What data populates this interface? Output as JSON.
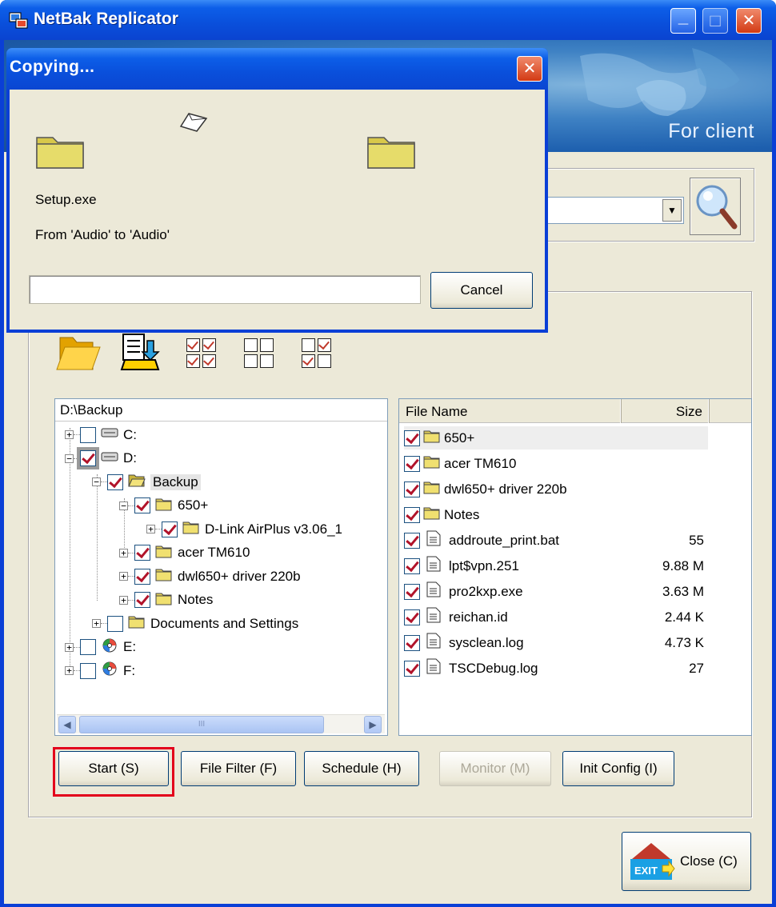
{
  "main_window": {
    "title": "NetBak Replicator",
    "banner_text": "For client",
    "controls": {
      "minimize": "_",
      "maximize": "□",
      "close": "✕"
    }
  },
  "copy_dialog": {
    "title": "Copying...",
    "file_name": "Setup.exe",
    "route": "From 'Audio' to 'Audio'",
    "cancel_label": "Cancel",
    "progress": 0
  },
  "tree": {
    "header": "D:\\Backup",
    "items": [
      {
        "label": "C:",
        "checked": false,
        "expander": "+",
        "icon": "drive-icon"
      },
      {
        "label": "D:",
        "checked": true,
        "expander": "−",
        "icon": "drive-icon"
      },
      {
        "label": "Backup",
        "checked": true,
        "expander": "−",
        "icon": "folder-open-icon"
      },
      {
        "label": "650+",
        "checked": true,
        "expander": "−",
        "icon": "folder-icon"
      },
      {
        "label": "D-Link AirPlus v3.06_1",
        "checked": true,
        "expander": "+",
        "icon": "folder-icon"
      },
      {
        "label": "acer TM610",
        "checked": true,
        "expander": "+",
        "icon": "folder-icon"
      },
      {
        "label": "dwl650+ driver 220b",
        "checked": true,
        "expander": "+",
        "icon": "folder-icon"
      },
      {
        "label": "Notes",
        "checked": true,
        "expander": "+",
        "icon": "folder-icon"
      },
      {
        "label": "Documents and Settings",
        "checked": false,
        "expander": "+",
        "icon": "folder-icon"
      },
      {
        "label": "E:",
        "checked": false,
        "expander": "+",
        "icon": "cd-drive-icon"
      },
      {
        "label": "F:",
        "checked": false,
        "expander": "+",
        "icon": "cd-drive-icon"
      }
    ],
    "scroll_thumb_mark": "III"
  },
  "files": {
    "columns": {
      "name": "File Name",
      "size": "Size"
    },
    "rows": [
      {
        "name": "650+",
        "size": "",
        "type": "folder"
      },
      {
        "name": "acer TM610",
        "size": "",
        "type": "folder"
      },
      {
        "name": "dwl650+ driver 220b",
        "size": "",
        "type": "folder"
      },
      {
        "name": "Notes",
        "size": "",
        "type": "folder"
      },
      {
        "name": "addroute_print.bat",
        "size": "55",
        "type": "file"
      },
      {
        "name": "lpt$vpn.251",
        "size": "9.88 M",
        "type": "file"
      },
      {
        "name": "pro2kxp.exe",
        "size": "3.63 M",
        "type": "file"
      },
      {
        "name": "reichan.id",
        "size": "2.44 K",
        "type": "file"
      },
      {
        "name": "sysclean.log",
        "size": "4.73 K",
        "type": "file"
      },
      {
        "name": "TSCDebug.log",
        "size": "27",
        "type": "file"
      }
    ]
  },
  "buttons": {
    "start": "Start (S)",
    "file_filter": "File Filter (F)",
    "schedule": "Schedule (H)",
    "monitor": "Monitor (M)",
    "init_config": "Init Config (I)",
    "close": "Close (C)",
    "exit_icon_text": "EXIT"
  },
  "toolbar": {
    "icons": [
      "open-folder-icon",
      "import-config-icon",
      "check-all-icon",
      "uncheck-all-icon",
      "invert-check-icon"
    ]
  },
  "colors": {
    "accent": "#0a4fdb",
    "check": "#b1132a",
    "highlight": "#e3001b"
  }
}
